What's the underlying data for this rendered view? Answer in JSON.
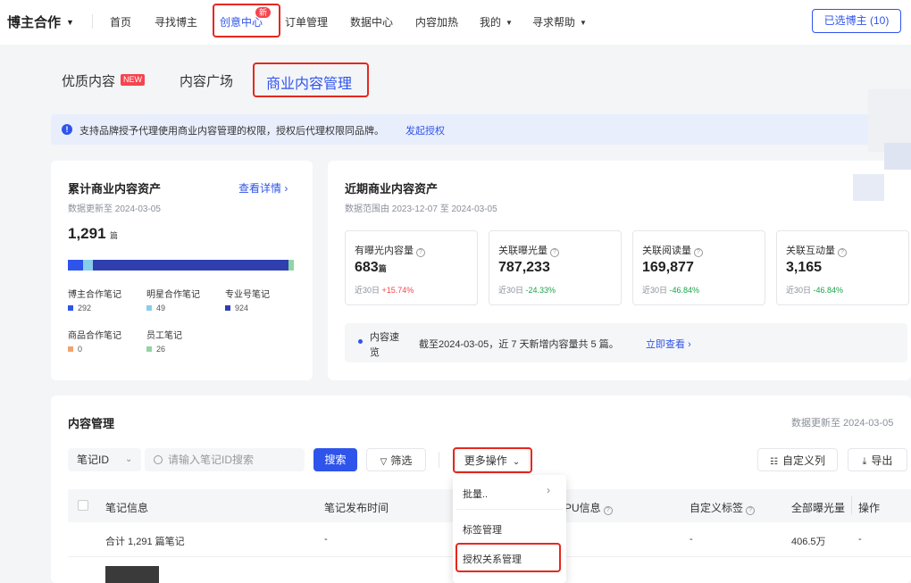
{
  "topnav": {
    "brand": "博主合作",
    "items": [
      "首页",
      "寻找博主",
      "创意中心",
      "订单管理",
      "数据中心",
      "内容加热",
      "我的",
      "寻求帮助"
    ],
    "new_badge": "新",
    "selected_button": "已选博主 (10)"
  },
  "subtabs": {
    "items": [
      "优质内容",
      "内容广场",
      "商业内容管理"
    ],
    "new_tag": "NEW"
  },
  "info_bar": {
    "text": "支持品牌授予代理使用商业内容管理的权限，授权后代理权限同品牌。",
    "link": "发起授权"
  },
  "cumulative": {
    "title": "累计商业内容资产",
    "link": "查看详情",
    "updated": "数据更新至 2024-03-05",
    "total": "1,291",
    "unit": "篇",
    "legend": [
      {
        "label": "博主合作笔记",
        "value": "292",
        "color": "#2f54eb"
      },
      {
        "label": "明星合作笔记",
        "value": "49",
        "color": "#87ceeb"
      },
      {
        "label": "专业号笔记",
        "value": "924",
        "color": "#2f3fae"
      },
      {
        "label": "商品合作笔记",
        "value": "0",
        "color": "#f0a46b"
      },
      {
        "label": "员工笔记",
        "value": "26",
        "color": "#8fd6a4"
      }
    ]
  },
  "recent": {
    "title": "近期商业内容资产",
    "range": "数据范围由 2023-12-07 至 2024-03-05",
    "metrics": [
      {
        "label": "有曝光内容量",
        "value": "683",
        "unit": "篇",
        "change_prefix": "近30日",
        "change": "+15.74%",
        "trend": "up"
      },
      {
        "label": "关联曝光量",
        "value": "787,233",
        "unit": "",
        "change_prefix": "近30日",
        "change": "-24.33%",
        "trend": "down"
      },
      {
        "label": "关联阅读量",
        "value": "169,877",
        "unit": "",
        "change_prefix": "近30日",
        "change": "-46.84%",
        "trend": "down"
      },
      {
        "label": "关联互动量",
        "value": "3,165",
        "unit": "",
        "change_prefix": "近30日",
        "change": "-46.84%",
        "trend": "down"
      }
    ],
    "speed_label_1": "内容速",
    "speed_label_2": "览",
    "speed_text": "截至2024-03-05，近 7 天新增内容量共 5 篇。",
    "speed_link": "立即查看"
  },
  "content_mgmt": {
    "title": "内容管理",
    "updated": "数据更新至 2024-03-05",
    "filter_select": "笔记ID",
    "search_placeholder": "请输入笔记ID搜索",
    "search_btn": "搜索",
    "filter_btn": "筛选",
    "more_btn": "更多操作",
    "custom_btn": "自定义列",
    "export_btn": "导出",
    "columns": [
      "笔记信息",
      "笔记发布时间",
      "PU信息",
      "自定义标签",
      "全部曝光量",
      "操作"
    ],
    "summary_row": {
      "label": "合计 1,291 篇笔记",
      "publish": "-",
      "tag": "-",
      "exposure": "406.5万",
      "op": "-"
    }
  },
  "dropdown": {
    "items": [
      "批量..",
      "标签管理",
      "授权关系管理"
    ]
  },
  "colors": {
    "accent": "#2f54eb",
    "highlight": "#e5281f",
    "up": "#f5454f",
    "down": "#19a34a"
  }
}
